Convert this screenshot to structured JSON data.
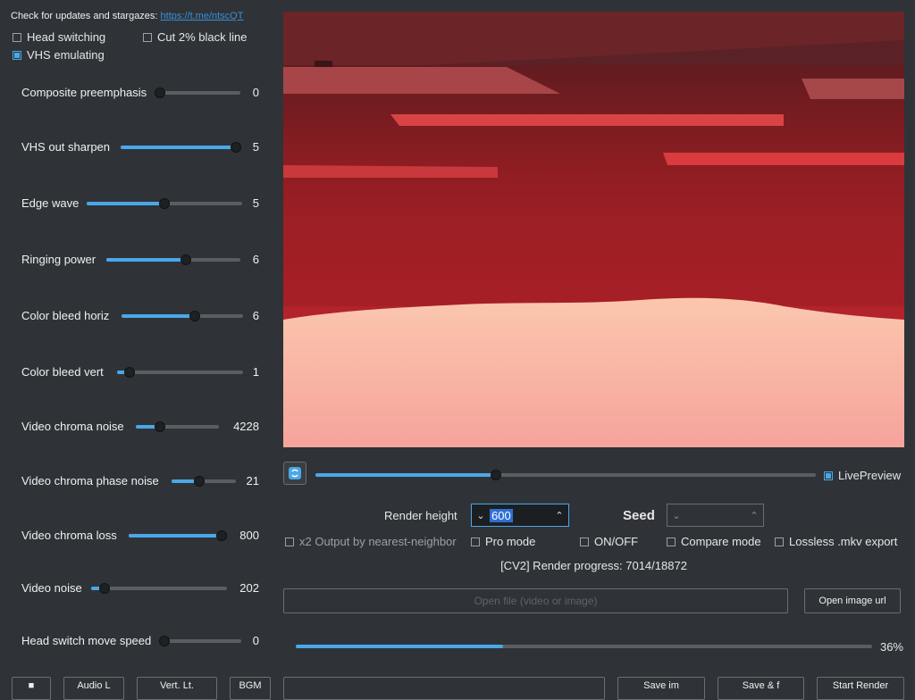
{
  "header": {
    "updates_text": "Check for updates and stargazes:",
    "updates_link": "https://t.me/ntscQT"
  },
  "checks": {
    "head_switching": "Head switching",
    "cut_black_line": "Cut 2% black line",
    "vhs_emulating": "VHS emulating"
  },
  "sliders": [
    {
      "label": "Composite preemphasis",
      "value": "0",
      "level": 0.0
    },
    {
      "label": "VHS out sharpen",
      "value": "5",
      "level": 1.0
    },
    {
      "label": "Edge wave",
      "value": "5",
      "level": 0.5
    },
    {
      "label": "Ringing power",
      "value": "6",
      "level": 0.59
    },
    {
      "label": "Color bleed horiz",
      "value": "6",
      "level": 0.6
    },
    {
      "label": "Color bleed vert",
      "value": "1",
      "level": 0.1
    },
    {
      "label": "Video chroma noise",
      "value": "4228",
      "level": 0.29
    },
    {
      "label": "Video chroma phase noise",
      "value": "21",
      "level": 0.43
    },
    {
      "label": "Video chroma loss",
      "value": "800",
      "level": 1.0
    },
    {
      "label": "Video noise",
      "value": "202",
      "level": 0.1
    },
    {
      "label": "Head switch move speed",
      "value": "0",
      "level": 0.0
    }
  ],
  "preview_controls": {
    "scrub_level": 0.36,
    "live_preview": "LivePreview"
  },
  "render": {
    "height_label": "Render height",
    "height_value": "600",
    "seed_label": "Seed",
    "seed_value": ""
  },
  "options": {
    "x2_output": "x2 Output by nearest-neighbor",
    "pro_mode": "Pro mode",
    "on_off": "ON/OFF",
    "compare_mode": "Compare mode",
    "lossless": "Lossless .mkv export"
  },
  "progress": {
    "text": "[CV2] Render progress: 7014/18872",
    "percent_text": "36%",
    "level": 0.36
  },
  "file": {
    "open_file": "Open file (video or image)",
    "open_url": "Open image url"
  },
  "bottom_buttons": {
    "b1": "■",
    "b2": "Audio L",
    "b3": "Vert. Lt.",
    "b4": "BGM",
    "b5": "Save im",
    "b6": "Save & f",
    "b7": "Start Render"
  },
  "colors": {
    "accent": "#4aa8e8",
    "background": "#2f3338"
  }
}
